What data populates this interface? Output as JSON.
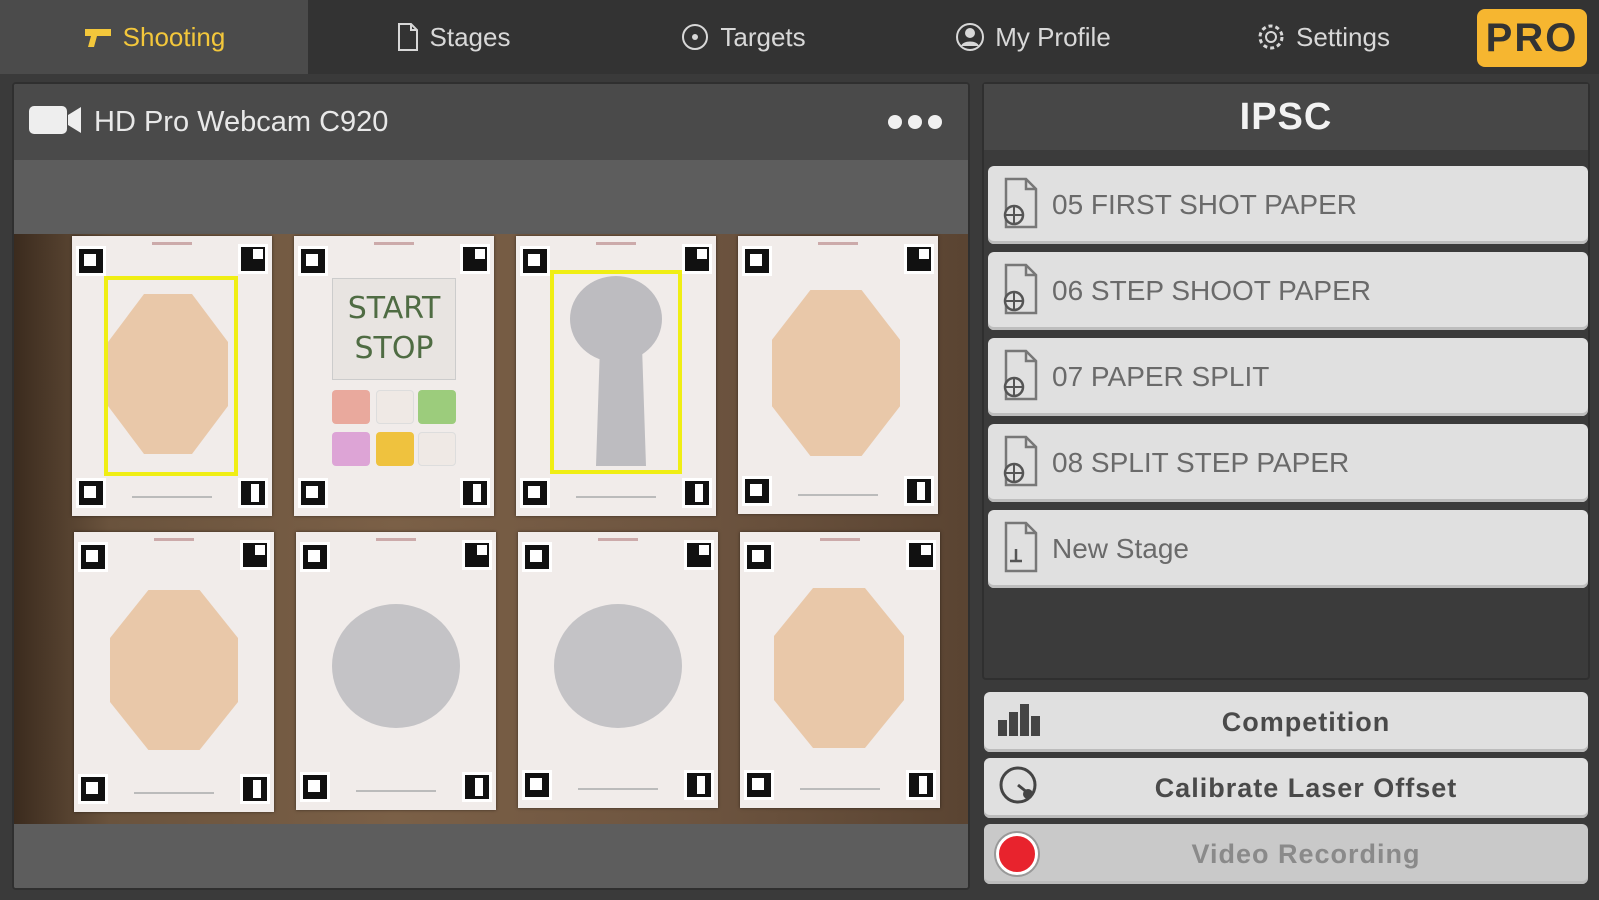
{
  "nav": {
    "tabs": [
      {
        "label": "Shooting",
        "icon": "gun-icon",
        "active": true
      },
      {
        "label": "Stages",
        "icon": "document-icon",
        "active": false
      },
      {
        "label": "Targets",
        "icon": "target-icon",
        "active": false
      },
      {
        "label": "My Profile",
        "icon": "profile-icon",
        "active": false
      },
      {
        "label": "Settings",
        "icon": "gear-icon",
        "active": false
      }
    ],
    "badge": "PRO"
  },
  "camera": {
    "title": "HD Pro Webcam C920",
    "icon": "video-camera-icon",
    "menu_icon": "more-dots-icon",
    "start_stop": {
      "line1": "START",
      "line2": "STOP"
    }
  },
  "stages_panel": {
    "title": "IPSC",
    "items": [
      {
        "label": "05 FIRST SHOT PAPER",
        "icon": "stage-file-icon"
      },
      {
        "label": "06 STEP SHOOT PAPER",
        "icon": "stage-file-icon"
      },
      {
        "label": "07 PAPER SPLIT",
        "icon": "stage-file-icon"
      },
      {
        "label": "08 SPLIT STEP PAPER",
        "icon": "stage-file-icon"
      },
      {
        "label": "New Stage",
        "icon": "new-stage-icon"
      }
    ]
  },
  "actions": {
    "competition": "Competition",
    "calibrate": "Calibrate Laser Offset",
    "video": "Video Recording"
  },
  "colors": {
    "accent": "#f3c73b",
    "pro_badge": "#f6b630",
    "selection": "#f0ee14",
    "record": "#e8232d"
  }
}
